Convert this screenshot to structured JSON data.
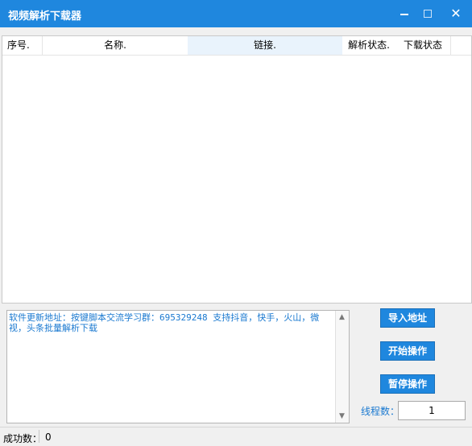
{
  "window": {
    "title": "视频解析下载器",
    "minimize_glyph": "",
    "maximize_glyph": "",
    "close_glyph": "✕"
  },
  "table": {
    "columns": [
      "序号.",
      "名称.",
      "链接.",
      "解析状态.",
      "下载状态"
    ],
    "rows": []
  },
  "log": {
    "text": "软件更新地址：按键脚本交流学习群：695329248 支持抖音，快手，火山，微视，头条批量解析下载"
  },
  "buttons": {
    "import": "导入地址",
    "start": "开始操作",
    "pause": "暂停操作"
  },
  "threads": {
    "label": "线程数：",
    "value": "1"
  },
  "status": {
    "label": "成功数：",
    "value": "0"
  },
  "colors": {
    "accent": "#1f87de",
    "log_text": "#1a79d0"
  },
  "icons": {
    "minimize": "minimize-icon",
    "maximize": "maximize-icon",
    "close": "close-icon",
    "scroll_up": "chevron-up-icon",
    "scroll_down": "chevron-down-icon"
  }
}
